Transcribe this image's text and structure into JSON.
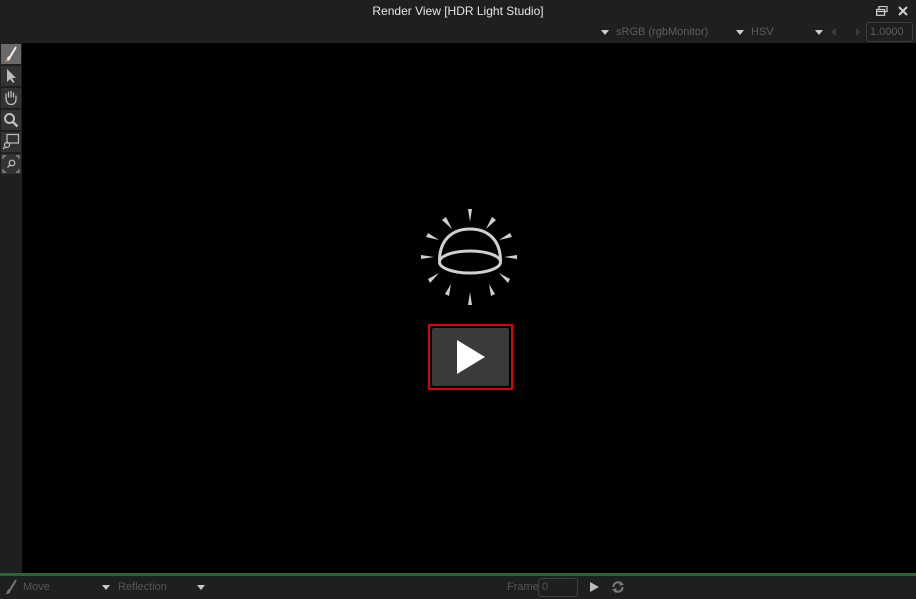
{
  "window": {
    "title": "Render View [HDR Light Studio]",
    "restore_icon": "restore-window-icon",
    "close_icon": "close-icon"
  },
  "toolbar": {
    "color_space": "sRGB (rgbMonitor)",
    "color_mode": "HSV",
    "exposure_value": "1.0000"
  },
  "tools": [
    {
      "name": "paint-tool",
      "icon": "brush-icon",
      "active": true
    },
    {
      "name": "select-tool",
      "icon": "arrow-cursor-icon",
      "active": false
    },
    {
      "name": "pan-tool",
      "icon": "hand-icon",
      "active": false
    },
    {
      "name": "zoom-tool",
      "icon": "magnifier-icon",
      "active": false
    },
    {
      "name": "zoom-region-tool",
      "icon": "zoom-rect-icon",
      "active": false
    },
    {
      "name": "zoom-fit-tool",
      "icon": "zoom-fit-icon",
      "active": false
    }
  ],
  "viewport": {
    "center_icon": "hdr-dome-light-icon",
    "play_button_icon": "play-icon",
    "highlight_color": "#e00000"
  },
  "statusbar": {
    "mode_icon": "brush-icon",
    "mode_label": "Move",
    "target_label": "Reflection",
    "frame_label": "Frame",
    "frame_value": "0",
    "play_icon": "play-icon",
    "loop_icon": "refresh-icon"
  },
  "colors": {
    "accent_line": "#1e6e2a",
    "background": "#1f1f1f",
    "viewport": "#000000"
  }
}
